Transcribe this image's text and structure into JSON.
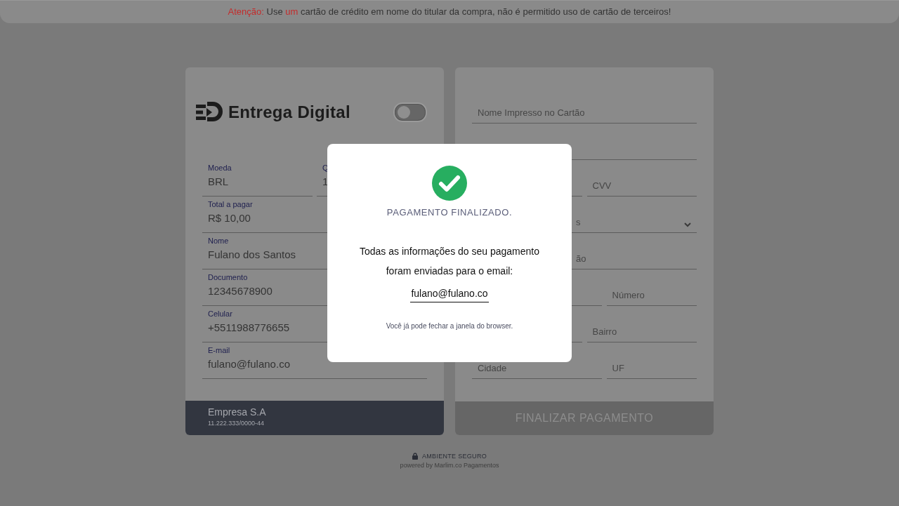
{
  "notice": {
    "segments": [
      {
        "text": "Atenção:",
        "highlight": true
      },
      {
        "text": " Use ",
        "highlight": false
      },
      {
        "text": "um",
        "highlight": true
      },
      {
        "text": " cartão de crédito em nome do titular da compra, não é permitido uso de cartão de terceiros!",
        "highlight": false
      }
    ]
  },
  "summary_card": {
    "brand": "Entrega Digital",
    "toggle": {
      "on": false
    },
    "rows": [
      {
        "fields": [
          {
            "label": "Moeda",
            "value": "BRL"
          },
          {
            "label": "Q",
            "value": "1"
          }
        ]
      },
      {
        "fields": [
          {
            "label": "Total a pagar",
            "value": "R$ 10,00"
          }
        ]
      },
      {
        "fields": [
          {
            "label": "Nome",
            "value": "Fulano dos Santos"
          }
        ]
      },
      {
        "fields": [
          {
            "label": "Documento",
            "value": "12345678900"
          }
        ]
      },
      {
        "fields": [
          {
            "label": "Celular",
            "value": "+5511988776655"
          }
        ]
      },
      {
        "fields": [
          {
            "label": "E-mail",
            "value": "fulano@fulano.co"
          }
        ]
      }
    ],
    "company": {
      "name": "Empresa S.A",
      "document": "11.222.333/0000-44"
    }
  },
  "payment_form": {
    "rows": [
      {
        "kind": "single",
        "fields": [
          {
            "kind": "text",
            "placeholder": "Nome Impresso no Cartão"
          }
        ]
      },
      {
        "kind": "single",
        "fields": [
          {
            "kind": "text"
          }
        ]
      },
      {
        "kind": "pair-even",
        "fields": [
          {
            "kind": "text"
          },
          {
            "kind": "text",
            "placeholder": "CVV"
          }
        ]
      },
      {
        "kind": "single",
        "fields": [
          {
            "kind": "select",
            "placeholder": "s",
            "covered": true
          }
        ]
      },
      {
        "kind": "single",
        "fields": [
          {
            "kind": "text",
            "placeholder": "ão",
            "covered": true
          }
        ]
      },
      {
        "kind": "pair-wide",
        "fields": [
          {
            "kind": "text"
          },
          {
            "kind": "text",
            "placeholder": "Número"
          }
        ]
      },
      {
        "kind": "pair-even",
        "fields": [
          {
            "kind": "text"
          },
          {
            "kind": "text",
            "placeholder": "Bairro"
          }
        ]
      },
      {
        "kind": "pair-wide",
        "fields": [
          {
            "kind": "text",
            "placeholder": "Cidade"
          },
          {
            "kind": "text",
            "placeholder": "UF"
          }
        ]
      }
    ],
    "submit": {
      "label": "FINALIZAR PAGAMENTO",
      "disabled": true
    }
  },
  "footer": {
    "secure": "AMBIENTE SEGURO",
    "powered": "powered by Marlim.co Pagamentos"
  },
  "dialog": {
    "title": "PAGAMENTO FINALIZADO.",
    "message": "Todas as informações do seu pagamento foram enviadas para o email:",
    "email": "fulano@fulano.co",
    "note": "Você já pode fechar a janela do browser."
  }
}
